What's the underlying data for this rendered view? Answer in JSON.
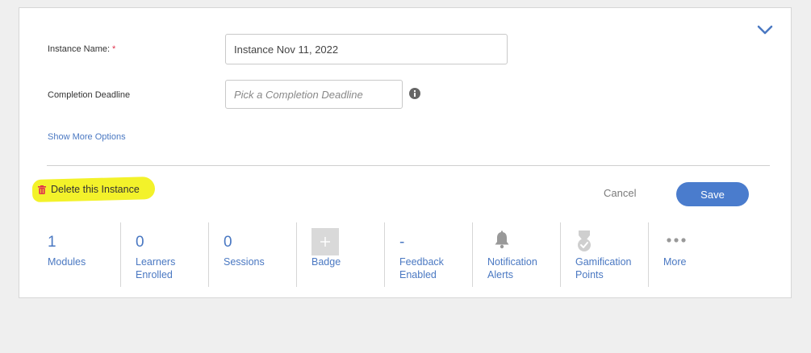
{
  "form": {
    "instance_name_label": "Instance Name:",
    "required_mark": "*",
    "instance_name_value": "Instance Nov 11, 2022",
    "deadline_label": "Completion Deadline",
    "deadline_placeholder": "Pick a Completion Deadline",
    "show_more": "Show More Options"
  },
  "actions": {
    "delete_label": "Delete this Instance",
    "cancel_label": "Cancel",
    "save_label": "Save"
  },
  "stats": [
    {
      "value": "1",
      "line1": "Modules",
      "line2": ""
    },
    {
      "value": "0",
      "line1": "Learners",
      "line2": "Enrolled"
    },
    {
      "value": "0",
      "line1": "Sessions",
      "line2": ""
    },
    {
      "icon": "plus-icon",
      "line1": "Badge",
      "line2": ""
    },
    {
      "value": "-",
      "line1": "Feedback",
      "line2": "Enabled"
    },
    {
      "icon": "bell-icon",
      "line1": "Notification",
      "line2": "Alerts"
    },
    {
      "icon": "medal-icon",
      "line1": "Gamification",
      "line2": "Points"
    },
    {
      "icon": "more-dots-icon",
      "line1": "More",
      "line2": ""
    }
  ],
  "colors": {
    "accent": "#4a78c2",
    "save_button": "#4a7ccd",
    "highlight": "#f3f22a",
    "required": "#e0334d",
    "trash": "#e0334d"
  }
}
